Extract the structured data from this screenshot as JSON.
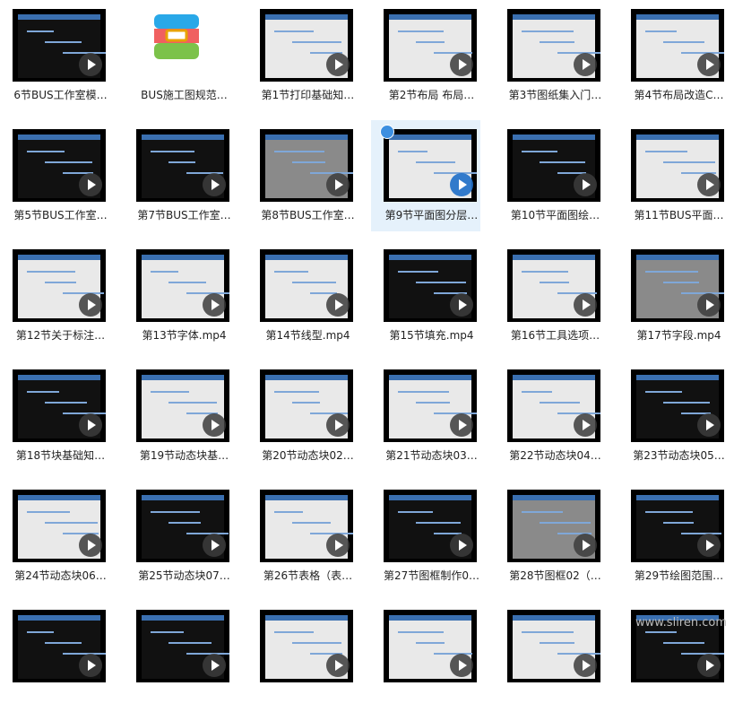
{
  "window": {
    "title": ""
  },
  "files": [
    {
      "label": "6节BUS工作室模…",
      "kind": "video",
      "theme": "dark"
    },
    {
      "label": "BUS施工图规范…",
      "kind": "archive",
      "theme": "none"
    },
    {
      "label": "第1节打印基础知…",
      "kind": "video",
      "theme": "light"
    },
    {
      "label": "第2节布局 布局…",
      "kind": "video",
      "theme": "light"
    },
    {
      "label": "第3节图纸集入门…",
      "kind": "video",
      "theme": "light"
    },
    {
      "label": "第4节布局改造C…",
      "kind": "video",
      "theme": "light"
    },
    {
      "label": "第5节BUS工作室…",
      "kind": "video",
      "theme": "dark"
    },
    {
      "label": "第7节BUS工作室…",
      "kind": "video",
      "theme": "dark"
    },
    {
      "label": "第8节BUS工作室…",
      "kind": "video",
      "theme": "mid"
    },
    {
      "label": "第9节平面图分层…",
      "kind": "video",
      "theme": "light",
      "selected": true
    },
    {
      "label": "第10节平面图绘…",
      "kind": "video",
      "theme": "dark"
    },
    {
      "label": "第11节BUS平面…",
      "kind": "video",
      "theme": "light"
    },
    {
      "label": "第12节关于标注…",
      "kind": "video",
      "theme": "light"
    },
    {
      "label": "第13节字体.mp4",
      "kind": "video",
      "theme": "light"
    },
    {
      "label": "第14节线型.mp4",
      "kind": "video",
      "theme": "light"
    },
    {
      "label": "第15节填充.mp4",
      "kind": "video",
      "theme": "dark"
    },
    {
      "label": "第16节工具选项…",
      "kind": "video",
      "theme": "light"
    },
    {
      "label": "第17节字段.mp4",
      "kind": "video",
      "theme": "mid"
    },
    {
      "label": "第18节块基础知…",
      "kind": "video",
      "theme": "dark"
    },
    {
      "label": "第19节动态块基…",
      "kind": "video",
      "theme": "light"
    },
    {
      "label": "第20节动态块02…",
      "kind": "video",
      "theme": "light"
    },
    {
      "label": "第21节动态块03…",
      "kind": "video",
      "theme": "light"
    },
    {
      "label": "第22节动态块04…",
      "kind": "video",
      "theme": "light"
    },
    {
      "label": "第23节动态块05…",
      "kind": "video",
      "theme": "dark"
    },
    {
      "label": "第24节动态块06…",
      "kind": "video",
      "theme": "light"
    },
    {
      "label": "第25节动态块07…",
      "kind": "video",
      "theme": "dark"
    },
    {
      "label": "第26节表格（表…",
      "kind": "video",
      "theme": "light"
    },
    {
      "label": "第27节图框制作0…",
      "kind": "video",
      "theme": "dark"
    },
    {
      "label": "第28节图框02（…",
      "kind": "video",
      "theme": "mid"
    },
    {
      "label": "第29节绘图范围…",
      "kind": "video",
      "theme": "dark"
    },
    {
      "label": "",
      "kind": "video",
      "theme": "dark"
    },
    {
      "label": "",
      "kind": "video",
      "theme": "dark"
    },
    {
      "label": "",
      "kind": "video",
      "theme": "light"
    },
    {
      "label": "",
      "kind": "video",
      "theme": "light"
    },
    {
      "label": "",
      "kind": "video",
      "theme": "light"
    },
    {
      "label": "",
      "kind": "video",
      "theme": "dark"
    }
  ],
  "watermark": "www.sliren.com",
  "colors": {
    "selected_bg": "#e5f1fb",
    "thumb_border": "#000000",
    "text": "#222222"
  }
}
